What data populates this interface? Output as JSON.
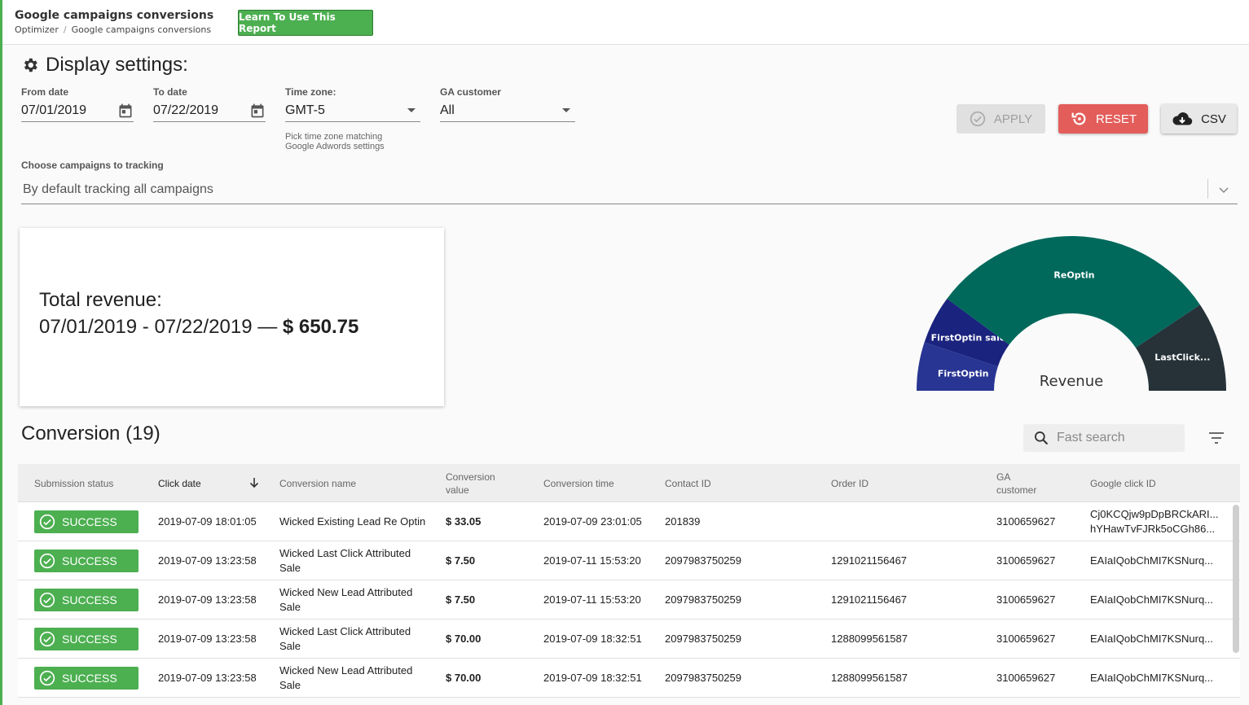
{
  "header": {
    "title": "Google campaigns conversions",
    "breadcrumb": [
      "Optimizer",
      "Google campaigns conversions"
    ],
    "breadcrumb_sep": "/",
    "learn_button": "Learn To Use This Report"
  },
  "settings": {
    "title": "Display settings:",
    "from_date_label": "From date",
    "from_date": "07/01/2019",
    "to_date_label": "To date",
    "to_date": "07/22/2019",
    "timezone_label": "Time zone:",
    "timezone": "GMT-5",
    "timezone_hint_1": "Pick time zone matching",
    "timezone_hint_2": "Google Adwords settings",
    "ga_customer_label": "GA customer",
    "ga_customer": "All",
    "apply_label": "APPLY",
    "reset_label": "RESET",
    "csv_label": "CSV",
    "campaigns_label": "Choose campaigns to tracking",
    "campaigns_placeholder": "By default tracking all campaigns"
  },
  "revenue": {
    "line1": "Total revenue:",
    "range": "07/01/2019 - 07/22/2019",
    "dash": "—",
    "amount": "$ 650.75"
  },
  "chart_data": {
    "type": "pie",
    "subtype": "half-donut",
    "title": "Revenue",
    "categories": [
      "FirstOptin",
      "FirstOptin sale",
      "ReOptin",
      "LastClick..."
    ],
    "values": [
      66,
      66,
      396,
      122
    ],
    "colors": [
      "#283593",
      "#1a237e",
      "#00695c",
      "#263238"
    ]
  },
  "conversions": {
    "title": "Conversion (19)",
    "search_placeholder": "Fast search",
    "columns": [
      {
        "l1": "Submission status",
        "l2": ""
      },
      {
        "l1": "Click date",
        "l2": ""
      },
      {
        "l1": "Conversion name",
        "l2": ""
      },
      {
        "l1": "Conversion",
        "l2": "value"
      },
      {
        "l1": "Conversion time",
        "l2": ""
      },
      {
        "l1": "Contact ID",
        "l2": ""
      },
      {
        "l1": "Order ID",
        "l2": ""
      },
      {
        "l1": "GA",
        "l2": "customer"
      },
      {
        "l1": "Google click ID",
        "l2": ""
      }
    ],
    "rows": [
      {
        "status": "SUCCESS",
        "click_date": "2019-07-09 18:01:05",
        "name_1": "Wicked Existing Lead Re Optin",
        "name_2": "",
        "value": "$ 33.05",
        "conv_time": "2019-07-09 23:01:05",
        "contact_id": "201839",
        "order_id": "",
        "ga_customer": "3100659627",
        "gclid_1": "Cj0KCQjw9pDpBRCkARI...",
        "gclid_2": "hYHawTvFJRk5oCGh86..."
      },
      {
        "status": "SUCCESS",
        "click_date": "2019-07-09 13:23:58",
        "name_1": "Wicked Last Click Attributed",
        "name_2": "Sale",
        "value": "$ 7.50",
        "conv_time": "2019-07-11 15:53:20",
        "contact_id": "2097983750259",
        "order_id": "1291021156467",
        "ga_customer": "3100659627",
        "gclid_1": "EAIaIQobChMI7KSNurq...",
        "gclid_2": ""
      },
      {
        "status": "SUCCESS",
        "click_date": "2019-07-09 13:23:58",
        "name_1": "Wicked New Lead Attributed",
        "name_2": "Sale",
        "value": "$ 7.50",
        "conv_time": "2019-07-11 15:53:20",
        "contact_id": "2097983750259",
        "order_id": "1291021156467",
        "ga_customer": "3100659627",
        "gclid_1": "EAIaIQobChMI7KSNurq...",
        "gclid_2": ""
      },
      {
        "status": "SUCCESS",
        "click_date": "2019-07-09 13:23:58",
        "name_1": "Wicked Last Click Attributed",
        "name_2": "Sale",
        "value": "$ 70.00",
        "conv_time": "2019-07-09 18:32:51",
        "contact_id": "2097983750259",
        "order_id": "1288099561587",
        "ga_customer": "3100659627",
        "gclid_1": "EAIaIQobChMI7KSNurq...",
        "gclid_2": ""
      },
      {
        "status": "SUCCESS",
        "click_date": "2019-07-09 13:23:58",
        "name_1": "Wicked New Lead Attributed",
        "name_2": "Sale",
        "value": "$ 70.00",
        "conv_time": "2019-07-09 18:32:51",
        "contact_id": "2097983750259",
        "order_id": "1288099561587",
        "ga_customer": "3100659627",
        "gclid_1": "EAIaIQobChMI7KSNurq...",
        "gclid_2": ""
      }
    ]
  },
  "colors": {
    "accent_green": "#4caf50",
    "reset_red": "#e35d5a"
  }
}
